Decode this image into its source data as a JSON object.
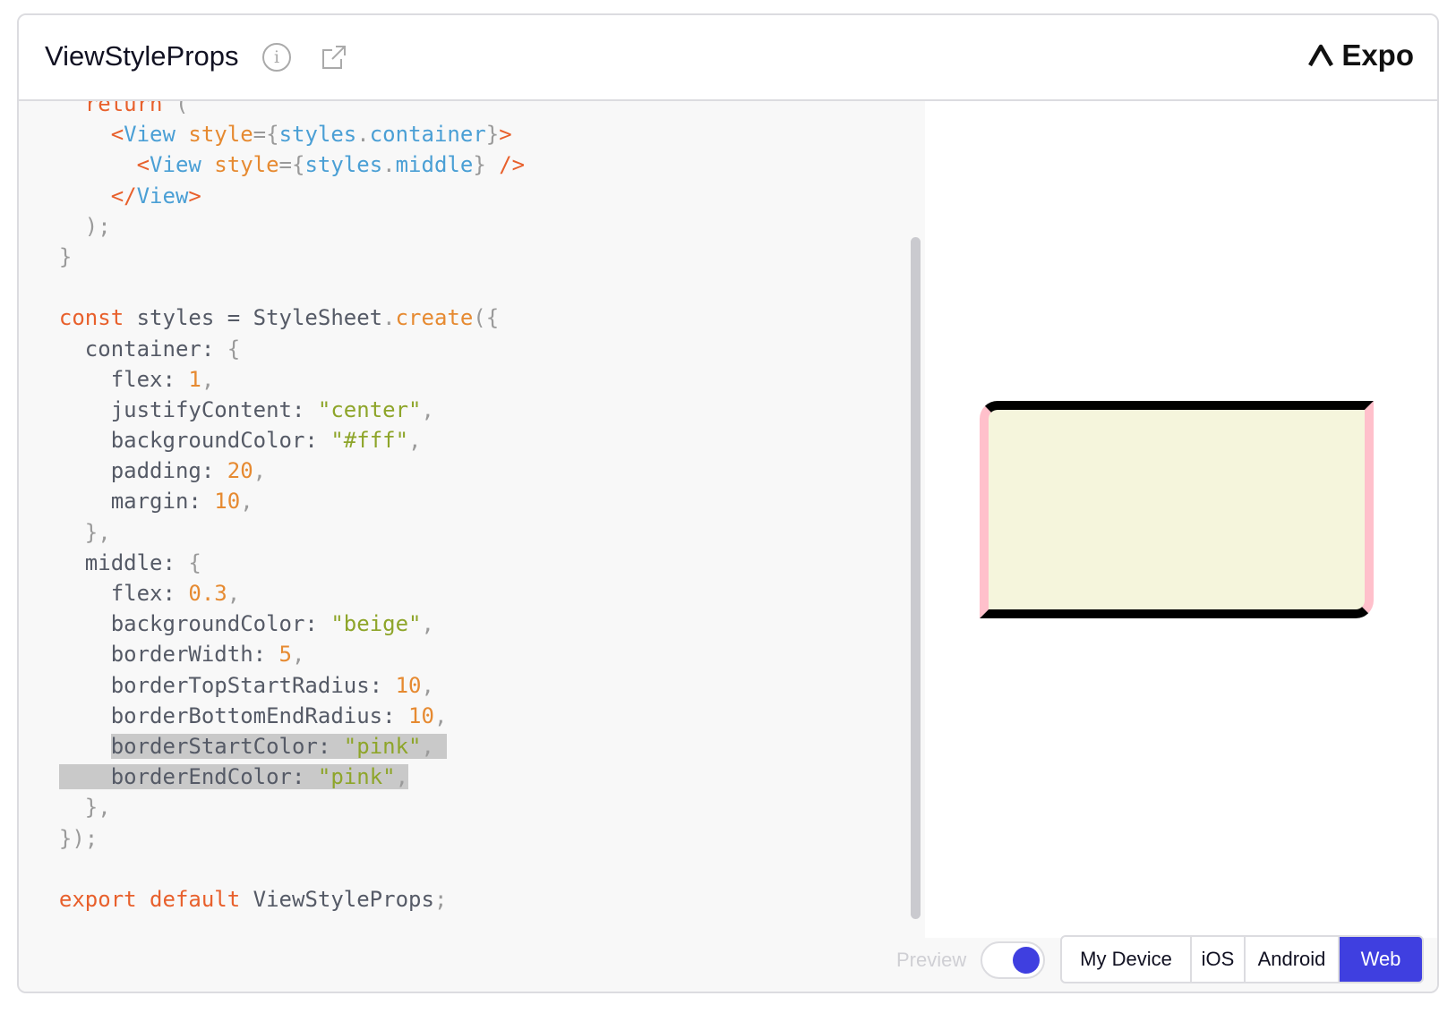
{
  "header": {
    "title": "ViewStyleProps",
    "brand": "Expo",
    "info_icon": "info-icon",
    "external_icon": "external-link-icon"
  },
  "colors": {
    "accent": "#3f3fe0",
    "keyword": "#e8602c",
    "tag_name": "#4a9fd5",
    "number": "#e68a31",
    "string": "#8ea52a",
    "preview_bg": "beige",
    "preview_border_side": "pink",
    "preview_border_main": "#000000"
  },
  "code": {
    "lines": [
      [
        [
          "t-kw",
          "    return "
        ],
        [
          "t-p",
          "("
        ]
      ],
      [
        [
          "t-tag",
          "      <"
        ],
        [
          "t-name",
          "View "
        ],
        [
          "t-attr",
          "style"
        ],
        [
          "t-p",
          "={"
        ],
        [
          "t-name",
          "styles"
        ],
        [
          "t-p",
          "."
        ],
        [
          "t-name",
          "container"
        ],
        [
          "t-p",
          "}"
        ],
        [
          "t-tag",
          ">"
        ]
      ],
      [
        [
          "t-tag",
          "        <"
        ],
        [
          "t-name",
          "View "
        ],
        [
          "t-attr",
          "style"
        ],
        [
          "t-p",
          "={"
        ],
        [
          "t-name",
          "styles"
        ],
        [
          "t-p",
          "."
        ],
        [
          "t-name",
          "middle"
        ],
        [
          "t-p",
          "} "
        ],
        [
          "t-tag",
          "/>"
        ]
      ],
      [
        [
          "t-tag",
          "      </"
        ],
        [
          "t-name",
          "View"
        ],
        [
          "t-tag",
          ">"
        ]
      ],
      [
        [
          "t-p",
          "    );"
        ]
      ],
      [
        [
          "t-p",
          "  }"
        ]
      ],
      [
        [
          "t-p",
          ""
        ]
      ],
      [
        [
          "t-kw",
          "  const "
        ],
        [
          "t-id",
          "styles = StyleSheet"
        ],
        [
          "t-p",
          "."
        ],
        [
          "t-fn",
          "create"
        ],
        [
          "t-p",
          "({"
        ]
      ],
      [
        [
          "t-id",
          "    container: "
        ],
        [
          "t-p",
          "{"
        ]
      ],
      [
        [
          "t-id",
          "      flex: "
        ],
        [
          "t-num",
          "1"
        ],
        [
          "t-p",
          ","
        ]
      ],
      [
        [
          "t-id",
          "      justifyContent: "
        ],
        [
          "t-str",
          "\"center\""
        ],
        [
          "t-p",
          ","
        ]
      ],
      [
        [
          "t-id",
          "      backgroundColor: "
        ],
        [
          "t-str",
          "\"#fff\""
        ],
        [
          "t-p",
          ","
        ]
      ],
      [
        [
          "t-id",
          "      padding: "
        ],
        [
          "t-num",
          "20"
        ],
        [
          "t-p",
          ","
        ]
      ],
      [
        [
          "t-id",
          "      margin: "
        ],
        [
          "t-num",
          "10"
        ],
        [
          "t-p",
          ","
        ]
      ],
      [
        [
          "t-p",
          "    },"
        ]
      ],
      [
        [
          "t-id",
          "    middle: "
        ],
        [
          "t-p",
          "{"
        ]
      ],
      [
        [
          "t-id",
          "      flex: "
        ],
        [
          "t-num",
          "0.3"
        ],
        [
          "t-p",
          ","
        ]
      ],
      [
        [
          "t-id",
          "      backgroundColor: "
        ],
        [
          "t-str",
          "\"beige\""
        ],
        [
          "t-p",
          ","
        ]
      ],
      [
        [
          "t-id",
          "      borderWidth: "
        ],
        [
          "t-num",
          "5"
        ],
        [
          "t-p",
          ","
        ]
      ],
      [
        [
          "t-id",
          "      borderTopStartRadius: "
        ],
        [
          "t-num",
          "10"
        ],
        [
          "t-p",
          ","
        ]
      ],
      [
        [
          "t-id",
          "      borderBottomEndRadius: "
        ],
        [
          "t-num",
          "10"
        ],
        [
          "t-p",
          ","
        ]
      ],
      [
        [
          "t-id",
          "      borderStartColor: "
        ],
        [
          "t-str",
          "\"pink\""
        ],
        [
          "t-p",
          ", "
        ]
      ],
      [
        [
          "t-id",
          "      borderEndColor: "
        ],
        [
          "t-str",
          "\"pink\""
        ],
        [
          "t-p",
          ","
        ]
      ],
      [
        [
          "t-p",
          "    },"
        ]
      ],
      [
        [
          "t-p",
          "  });"
        ]
      ],
      [
        [
          "t-p",
          ""
        ]
      ],
      [
        [
          "t-kw",
          "  export default "
        ],
        [
          "t-id",
          "ViewStyleProps"
        ],
        [
          "t-p",
          ";"
        ]
      ]
    ]
  },
  "footer": {
    "preview_label": "Preview",
    "preview_enabled": true,
    "platforms": [
      "My Device",
      "iOS",
      "Android",
      "Web"
    ],
    "selected_platform": "Web"
  }
}
